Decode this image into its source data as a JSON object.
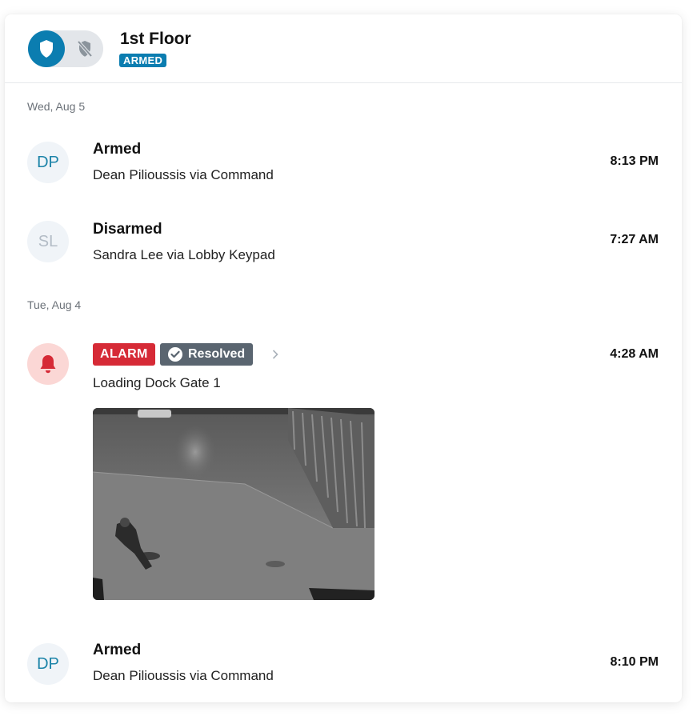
{
  "header": {
    "title": "1st Floor",
    "status_badge": "ARMED",
    "toggle_on_icon": "shield-icon",
    "toggle_off_icon": "shield-off-icon"
  },
  "colors": {
    "accent": "#0b7db0",
    "alarm": "#d62a36",
    "resolved": "#5a6570"
  },
  "groups": [
    {
      "date": "Wed, Aug 5",
      "events": [
        {
          "avatar": "DP",
          "title": "Armed",
          "subtitle": "Dean Pilioussis via Command",
          "time": "8:13 PM"
        },
        {
          "avatar": "SL",
          "title": "Disarmed",
          "subtitle": "Sandra Lee via Lobby Keypad",
          "time": "7:27 AM"
        }
      ]
    },
    {
      "date": "Tue, Aug 4",
      "events": [
        {
          "avatar_icon": "bell-icon",
          "alarm_label": "ALARM",
          "resolved_label": "Resolved",
          "subtitle": "Loading Dock Gate 1",
          "time": "4:28 AM",
          "snapshot_icon": "camera-snapshot"
        },
        {
          "avatar": "DP",
          "title": "Armed",
          "subtitle": "Dean Pilioussis via Command",
          "time": "8:10 PM"
        }
      ]
    }
  ]
}
